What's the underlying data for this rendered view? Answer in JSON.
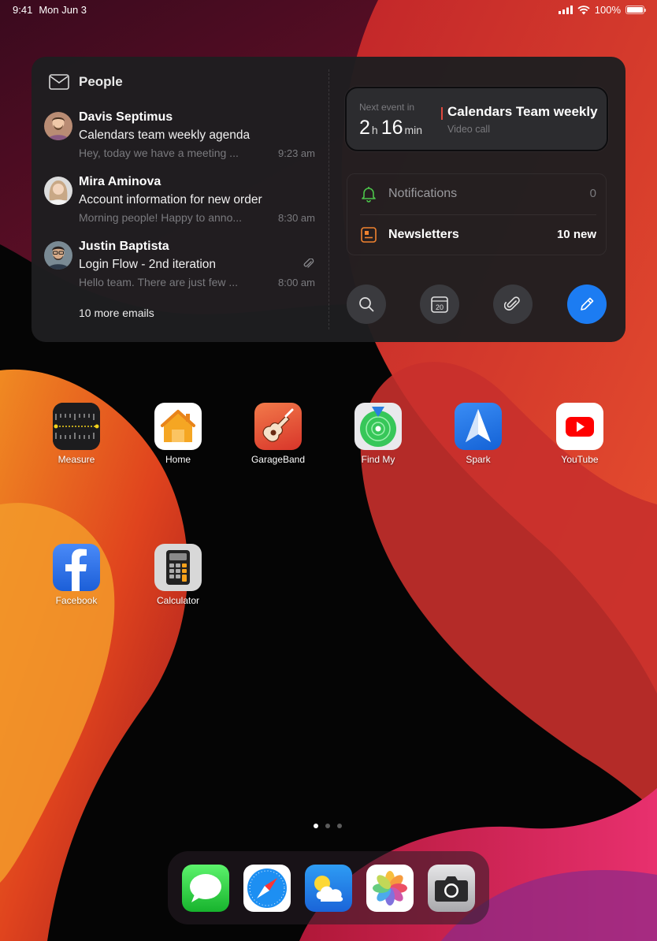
{
  "status_bar": {
    "time": "9:41",
    "date": "Mon Jun 3",
    "battery": "100%",
    "battery_level": 1.0
  },
  "widget": {
    "people": {
      "title": "People",
      "icon": "mail-icon",
      "emails": [
        {
          "sender": "Davis Septimus",
          "subject": "Calendars team weekly agenda",
          "preview": "Hey, today we have a meeting ...",
          "time": "9:23 am",
          "has_attachment": false
        },
        {
          "sender": "Mira Aminova",
          "subject": "Account information for new order",
          "preview": "Morning people! Happy to anno...",
          "time": "8:30 am",
          "has_attachment": false
        },
        {
          "sender": "Justin Baptista",
          "subject": "Login Flow - 2nd iteration",
          "preview": "Hello team. There are just few ...",
          "time": "8:00 am",
          "has_attachment": true
        }
      ],
      "more_emails": "10 more emails"
    },
    "next_event": {
      "label": "Next event in",
      "hours": "2",
      "hours_unit": "h",
      "minutes": "16",
      "minutes_unit": "min",
      "title": "Calendars Team weekly",
      "subtitle": "Video call",
      "accent": "#e0483e"
    },
    "lists": [
      {
        "label": "Notifications",
        "value": "0",
        "icon": "bell-icon",
        "icon_color": "#4cc44a"
      },
      {
        "label": "Newsletters",
        "value": "10 new",
        "icon": "newsletter-icon",
        "icon_color": "#f0822f"
      }
    ],
    "actions": [
      {
        "name": "search",
        "icon": "search-icon"
      },
      {
        "name": "calendar",
        "icon": "calendar-icon",
        "text": "20"
      },
      {
        "name": "attachments",
        "icon": "paperclip-icon"
      },
      {
        "name": "compose",
        "icon": "pencil-icon",
        "color": "#1c7cf2"
      }
    ]
  },
  "apps": [
    {
      "label": "Measure",
      "icon": "measure-icon"
    },
    {
      "label": "Home",
      "icon": "home-icon"
    },
    {
      "label": "GarageBand",
      "icon": "guitar-icon"
    },
    {
      "label": "Find My",
      "icon": "find-my-icon"
    },
    {
      "label": "Spark",
      "icon": "spark-icon"
    },
    {
      "label": "YouTube",
      "icon": "youtube-icon"
    },
    {
      "label": "Facebook",
      "icon": "facebook-icon"
    },
    {
      "label": "Calculator",
      "icon": "calculator-icon"
    }
  ],
  "page_indicator": {
    "pages": 3,
    "current": 1
  },
  "dock": [
    {
      "name": "Messages",
      "icon": "messages-icon"
    },
    {
      "name": "Safari",
      "icon": "safari-icon"
    },
    {
      "name": "Weather",
      "icon": "weather-icon"
    },
    {
      "name": "Photos",
      "icon": "photos-icon"
    },
    {
      "name": "Camera",
      "icon": "camera-icon"
    }
  ]
}
